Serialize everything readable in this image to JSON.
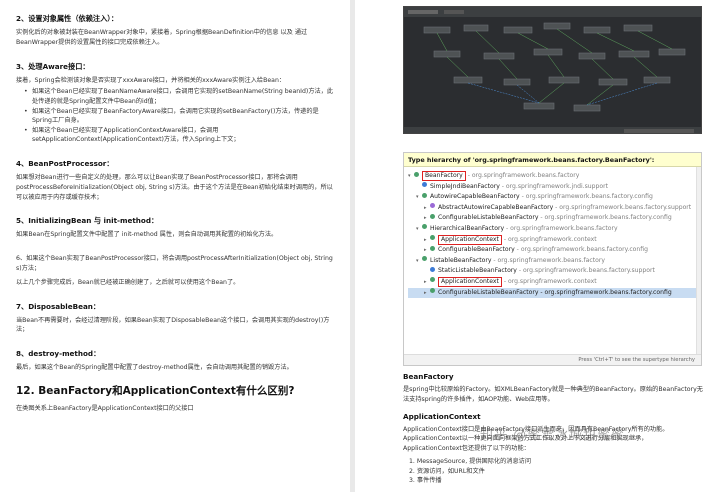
{
  "left": {
    "s2": {
      "title": "2、设置对象属性（依赖注入）：",
      "body": "实例化后的对象被封装在BeanWrapper对象中，紧接着，Spring根据BeanDefinition中的信息 以及 通过BeanWrapper提供的设置属性的接口完成依赖注入。"
    },
    "s3": {
      "title": "3、处理Aware接口：",
      "intro": "接着，Spring会检测该对象是否实现了xxxAware接口，并将相关的xxxAware实例注入给Bean：",
      "items": [
        "如果这个Bean已经实现了BeanNameAware接口，会调用它实现的setBeanName(String beanId)方法，此处传递的就是Spring配置文件中Bean的id值；",
        "如果这个Bean已经实现了BeanFactoryAware接口，会调用它实现的setBeanFactory()方法，传递的是Spring工厂自身。",
        "如果这个Bean已经实现了ApplicationContextAware接口，会调用setApplicationContext(ApplicationContext)方法，传入Spring上下文；"
      ]
    },
    "s4": {
      "title": "4、BeanPostProcessor：",
      "body": "如果想对Bean进行一些自定义的处理，那么可以让Bean实现了BeanPostProcessor接口，那将会调用postProcessBeforeInitialization(Object obj, String s)方法。由于这个方法是在Bean初始化结束时调用的，所以可以被应用于内存或缓存技术；"
    },
    "s5": {
      "title": "5、InitializingBean 与 init-method：",
      "body": "如果Bean在Spring配置文件中配置了 init-method 属性，则会自动调用其配置的初始化方法。"
    },
    "s6": {
      "title": "6、如果这个Bean实现了BeanPostProcessor接口，将会调用postProcessAfterInitialization(Object obj, String s)方法；",
      "body": "以上几个步骤完成后，Bean就已经被正确创建了，之后就可以使用这个Bean了。"
    },
    "s7": {
      "title": "7、DisposableBean：",
      "body": "当Bean不再需要时，会经过清理阶段，如果Bean实现了DisposableBean这个接口，会调用其实现的destroy()方法；"
    },
    "s8": {
      "title": "8、destroy-method：",
      "body": "最后，如果这个Bean的Spring配置中配置了destroy-method属性，会自动调用其配置的销毁方法。"
    },
    "h12": "12. BeanFactory和ApplicationContext有什么区别?",
    "after12": "在类图关系上BeanFactory是ApplicationContext接口的父接口"
  },
  "hierarchy": {
    "title": "Type hierarchy of 'org.springframework.beans.factory.BeanFactory':",
    "rows": [
      {
        "name": "BeanFactory",
        "pkg": " - org.springframework.beans.factory"
      },
      {
        "name": "SimpleJndiBeanFactory",
        "pkg": " - org.springframework.jndi.support"
      },
      {
        "name": "AutowireCapableBeanFactory",
        "pkg": " - org.springframework.beans.factory.config"
      },
      {
        "name": "AbstractAutowireCapableBeanFactory",
        "pkg": " - org.springframework.beans.factory.support"
      },
      {
        "name": "ConfigurableListableBeanFactory",
        "pkg": " - org.springframework.beans.factory.config"
      },
      {
        "name": "HierarchicalBeanFactory",
        "pkg": " - org.springframework.beans.factory"
      },
      {
        "name": "ApplicationContext",
        "pkg": " - org.springframework.context"
      },
      {
        "name": "ConfigurableBeanFactory",
        "pkg": " - org.springframework.beans.factory.config"
      },
      {
        "name": "ListableBeanFactory",
        "pkg": " - org.springframework.beans.factory"
      },
      {
        "name": "StaticListableBeanFactory",
        "pkg": " - org.springframework.beans.factory.support"
      },
      {
        "name": "ApplicationContext",
        "pkg": " - org.springframework.context"
      },
      {
        "name": "ConfigurableListableBeanFactory",
        "pkg": " - org.springframework.beans.factory.config"
      }
    ],
    "footer": "Press 'Ctrl+T' to see the supertype hierarchy"
  },
  "right": {
    "bf_title": "BeanFactory",
    "bf_body": "是spring中比较原始的Factory。如XMLBeanFactory就是一种典型的BeanFactory。原始的BeanFactory无法支持spring的许多插件，如AOP功能、Web应用等。",
    "ac_title": "ApplicationContext",
    "ac_body": "ApplicationContext接口是由BeanFactory接口派生而来，因而具有BeanFactory所有的功能。ApplicationContext以一种更向面向框架的方式工作以及对上下文进行分层和实现继承，ApplicationContext包还提供了以下的功能：",
    "list": [
      "1. MessageSource, 提供国际化的消息访问",
      "2. 资源访问，如URL和文件",
      "3. 事件传播"
    ],
    "watermark": "知乎 @蜜雪冰城甜蜜蜜"
  }
}
